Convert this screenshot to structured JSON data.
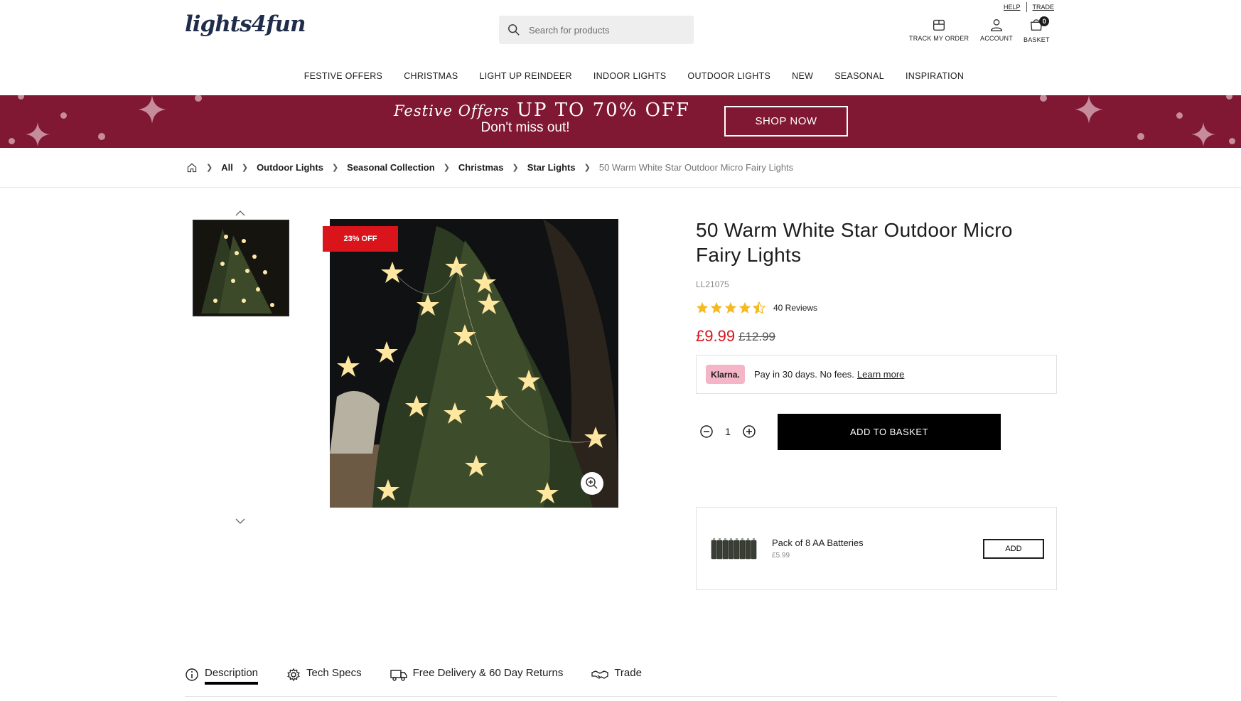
{
  "header": {
    "logo_text": "lights4fun",
    "search_placeholder": "Search for products",
    "top_links": [
      "HELP",
      "TRADE"
    ],
    "track_order_label": "TRACK MY ORDER",
    "account_label": "ACCOUNT",
    "basket_label": "BASKET",
    "basket_count": "0"
  },
  "nav": {
    "items": [
      "FESTIVE OFFERS",
      "CHRISTMAS",
      "LIGHT UP REINDEER",
      "INDOOR LIGHTS",
      "OUTDOOR LIGHTS",
      "NEW",
      "SEASONAL",
      "INSPIRATION"
    ]
  },
  "banner": {
    "script_text": "Festive Offers",
    "headline": "UP TO 70% OFF",
    "subline": "Don't miss out!",
    "cta_label": "SHOP NOW",
    "background_color": "#801733"
  },
  "breadcrumb": {
    "items": [
      "All",
      "Outdoor Lights",
      "Seasonal Collection",
      "Christmas",
      "Star Lights"
    ],
    "current": "50 Warm White Star Outdoor Micro Fairy Lights"
  },
  "gallery": {
    "discount_badge": "23% OFF"
  },
  "product": {
    "title": "50 Warm White Star Outdoor Micro Fairy Lights",
    "sku": "LL21075",
    "rating": 4.5,
    "reviews_label": "40 Reviews",
    "price": "£9.99",
    "was_price": "£12.99",
    "price_color": "#d9141b",
    "klarna_badge": "Klarna.",
    "klarna_text": "Pay in 30 days. No fees.",
    "klarna_link": "Learn more",
    "quantity": "1",
    "add_to_basket_label": "ADD TO BASKET"
  },
  "addon": {
    "name": "Pack of 8 AA Batteries",
    "price": "£5.99",
    "add_label": "ADD"
  },
  "tabs": {
    "items": [
      "Description",
      "Tech Specs",
      "Free Delivery & 60 Day Returns",
      "Trade"
    ],
    "active": "Description"
  }
}
